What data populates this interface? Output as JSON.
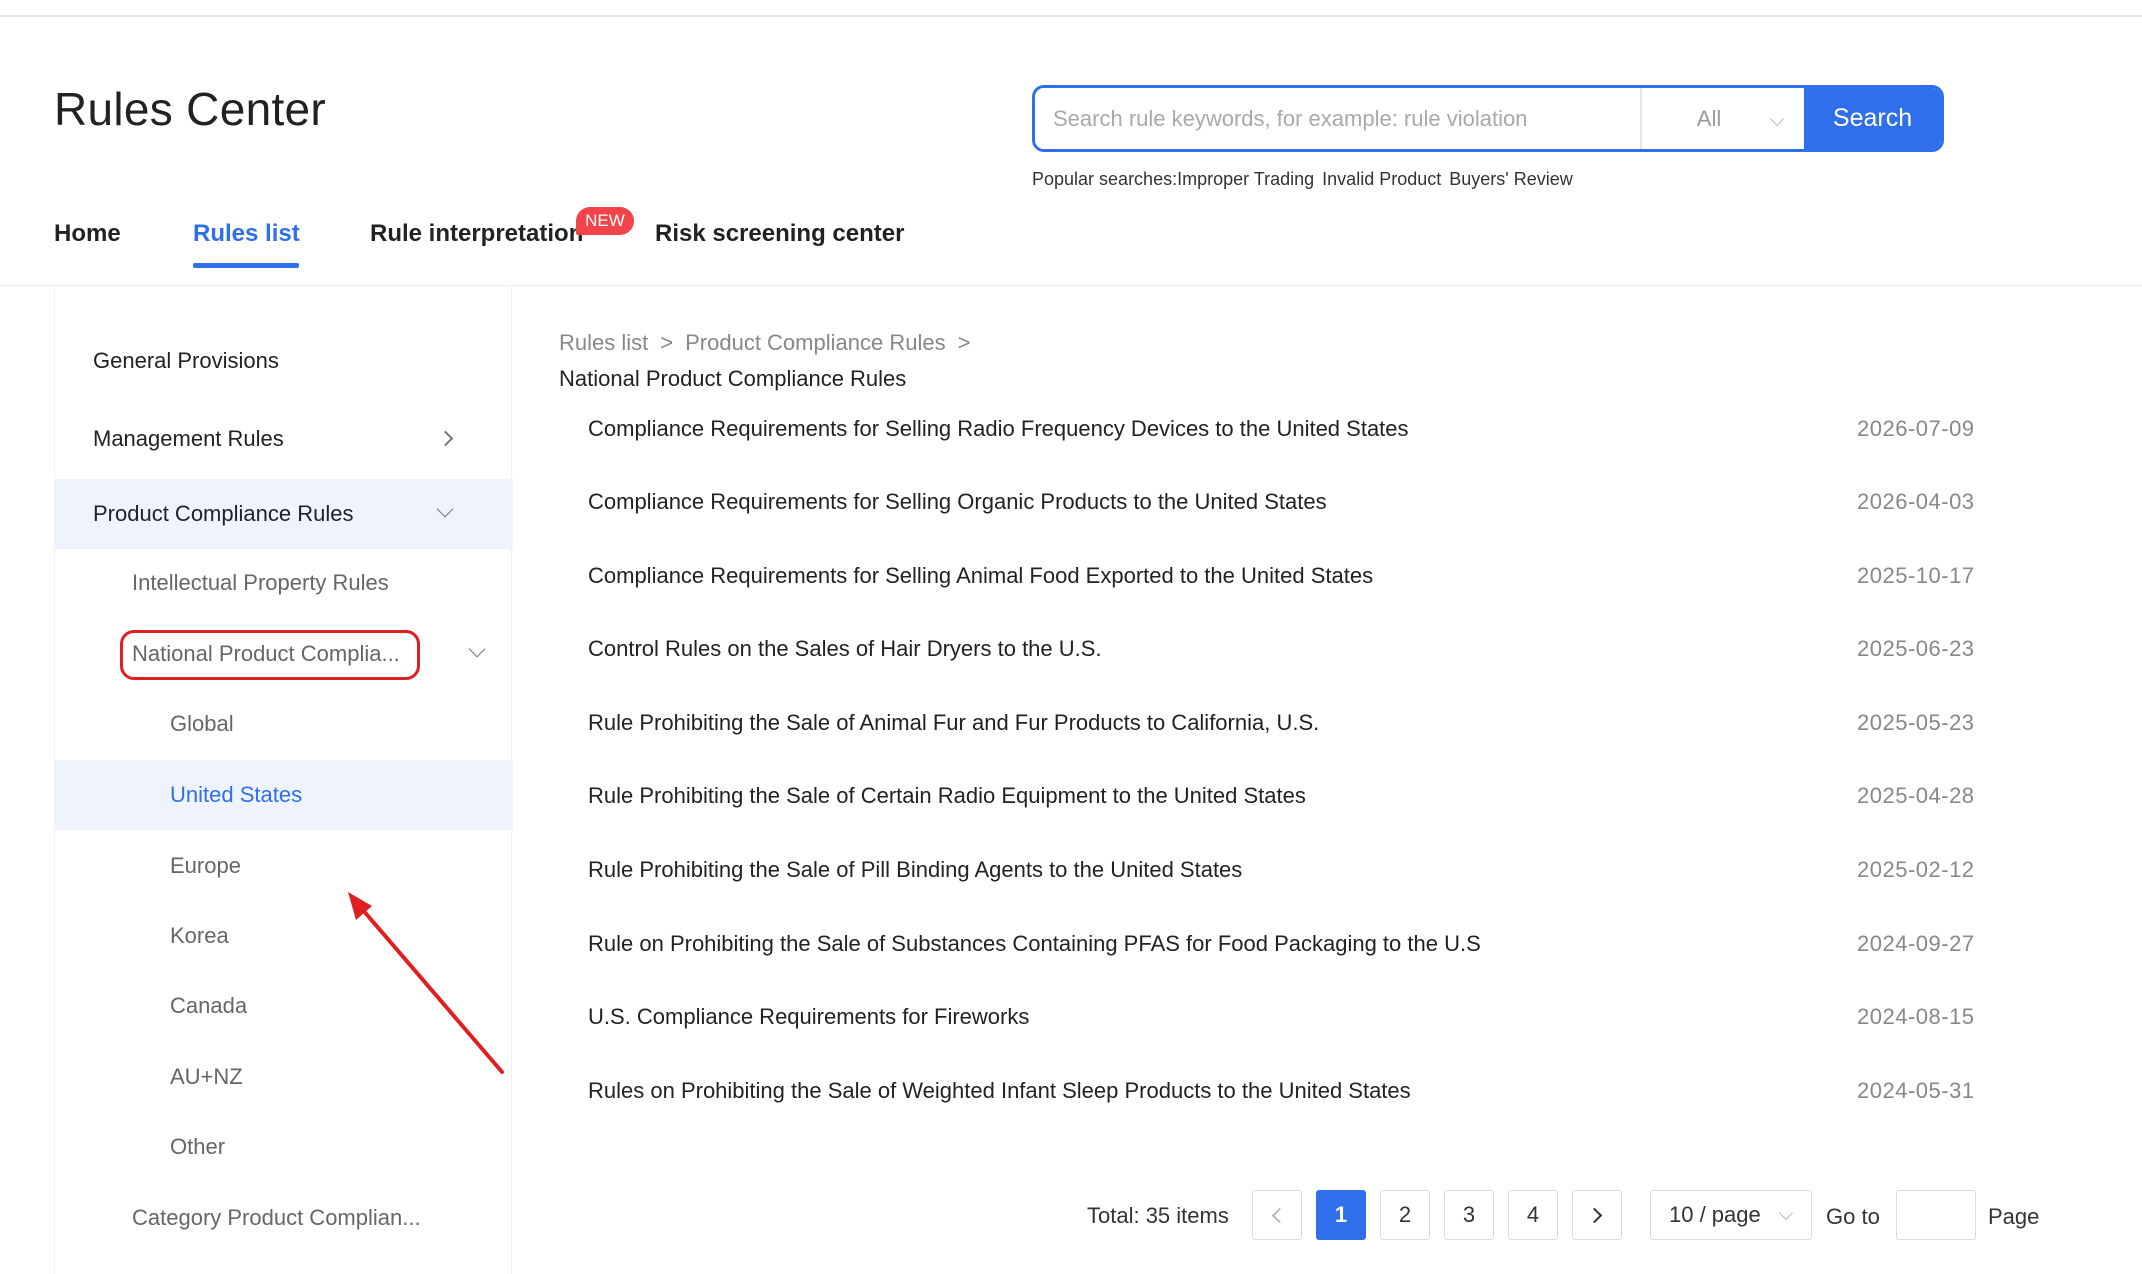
{
  "app": {
    "title": "Rules Center"
  },
  "search": {
    "placeholder": "Search rule keywords, for example: rule violation",
    "value": "",
    "scope": "All",
    "button_label": "Search",
    "popular_label": "Popular searches:",
    "popular_terms": [
      "Improper Trading",
      "Invalid Product",
      "Buyers' Review"
    ]
  },
  "nav": {
    "items": [
      {
        "label": "Home",
        "active": false
      },
      {
        "label": "Rules list",
        "active": true
      },
      {
        "label": "Rule interpretation",
        "active": false,
        "badge": "NEW"
      },
      {
        "label": "Risk screening center",
        "active": false
      }
    ]
  },
  "sidebar": {
    "items": [
      {
        "label": "General Provisions",
        "level": 1
      },
      {
        "label": "Management Rules",
        "level": 1,
        "icon": "chevron-right-icon"
      },
      {
        "label": "Product Compliance Rules",
        "level": 1,
        "icon": "chevron-down-icon",
        "expanded": true
      },
      {
        "label": "Intellectual Property Rules",
        "level": 2
      },
      {
        "label": "National Product Complia...",
        "level": 2,
        "icon": "chevron-down-icon",
        "expanded": true,
        "annotated": true
      },
      {
        "label": "Global",
        "level": 3
      },
      {
        "label": "United States",
        "level": 3,
        "selected": true
      },
      {
        "label": "Europe",
        "level": 3
      },
      {
        "label": "Korea",
        "level": 3
      },
      {
        "label": "Canada",
        "level": 3
      },
      {
        "label": "AU+NZ",
        "level": 3
      },
      {
        "label": "Other",
        "level": 3
      },
      {
        "label": "Category Product Complian...",
        "level": 2
      }
    ]
  },
  "breadcrumb": {
    "items": [
      "Rules list",
      "Product Compliance Rules"
    ],
    "separator": ">",
    "current": "National Product Compliance Rules"
  },
  "rules": [
    {
      "title": "Compliance Requirements for Selling Radio Frequency Devices to the United States",
      "date": "2026-07-09"
    },
    {
      "title": "Compliance Requirements for Selling Organic Products to the United States",
      "date": "2026-04-03"
    },
    {
      "title": "Compliance Requirements for Selling Animal Food Exported to the United States",
      "date": "2025-10-17"
    },
    {
      "title": "Control Rules on the Sales of Hair Dryers to the U.S.",
      "date": "2025-06-23"
    },
    {
      "title": "Rule Prohibiting the Sale of Animal Fur and Fur Products to California, U.S.",
      "date": "2025-05-23"
    },
    {
      "title": "Rule Prohibiting the Sale of Certain Radio Equipment to the United States",
      "date": "2025-04-28"
    },
    {
      "title": "Rule Prohibiting the Sale of Pill Binding Agents to the United States",
      "date": "2025-02-12"
    },
    {
      "title": "Rule on Prohibiting the Sale of Substances Containing PFAS for Food Packaging to the U.S",
      "date": "2024-09-27"
    },
    {
      "title": "U.S. Compliance Requirements for Fireworks",
      "date": "2024-08-15"
    },
    {
      "title": "Rules on Prohibiting the Sale of Weighted Infant Sleep Products to the United States",
      "date": "2024-05-31"
    }
  ],
  "pagination": {
    "total_label": "Total: 35 items",
    "pages": [
      "1",
      "2",
      "3",
      "4"
    ],
    "current_page": "1",
    "page_size_label": "10 / page",
    "goto_label": "Go to",
    "goto_value": "",
    "page_label": "Page"
  },
  "colors": {
    "accent": "#2f6fec",
    "badge": "#f0444a",
    "annotation": "#e02020",
    "selected_bg": "#eef3fd"
  }
}
